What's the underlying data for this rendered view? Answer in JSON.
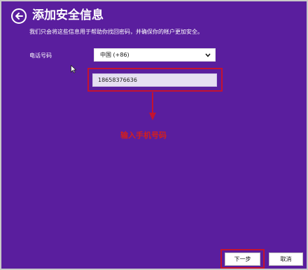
{
  "header": {
    "title": "添加安全信息",
    "back_icon": "back-arrow-icon"
  },
  "description": "我们只会将这些信息用于帮助你找回密码，并确保你的帐户更加安全。",
  "phone": {
    "label": "电话号码",
    "country_value": "中国 (+86)",
    "number_value": "18658376636"
  },
  "annotation": {
    "text": "输入手机号码",
    "color": "#d11f1f"
  },
  "buttons": {
    "next_label": "下一步",
    "cancel_label": "取消"
  },
  "colors": {
    "background": "#5a1e9e",
    "highlight": "#c41230"
  }
}
